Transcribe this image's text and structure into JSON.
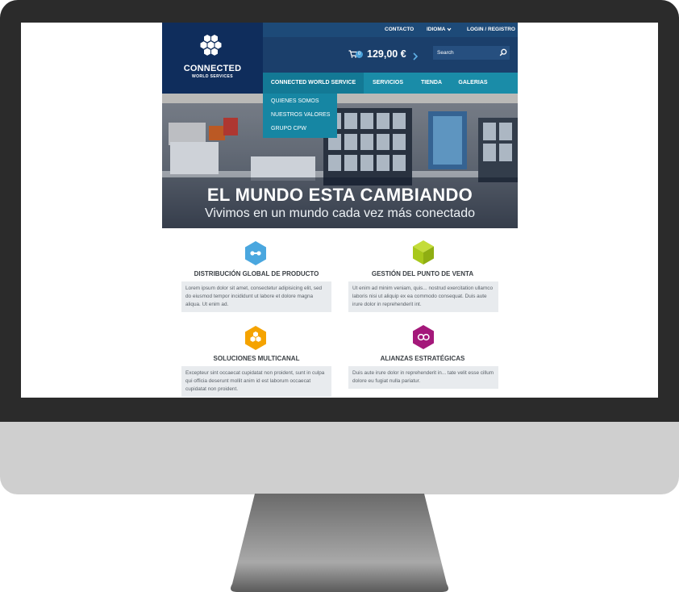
{
  "topbar": {
    "contacto": "CONTACTO",
    "idioma": "IDIOMA",
    "login": "LOGIN / REGISTRO"
  },
  "logo": {
    "title": "CONNECTED",
    "subtitle": "WORLD SERVICES"
  },
  "header": {
    "cart_count": "0",
    "price": "129,00 €",
    "search_placeholder": "Search"
  },
  "nav": {
    "items": [
      {
        "label": "CONNECTED WORLD SERVICE"
      },
      {
        "label": "SERVICIOS"
      },
      {
        "label": "TIENDA"
      },
      {
        "label": "GALERIAS"
      }
    ]
  },
  "dropdown": {
    "items": [
      {
        "label": "QUIENES SOMOS"
      },
      {
        "label": "NUESTROS VALORES"
      },
      {
        "label": "GRUPO CPW"
      }
    ]
  },
  "hero": {
    "title": "EL MUNDO ESTA CAMBIANDO",
    "subtitle": "Vivimos en un mundo cada vez más conectado"
  },
  "features": [
    {
      "title": "DISTRIBUCIÓN GLOBAL DE PRODUCTO",
      "text": "Lorem ipsum dolor sit amet, consectetur adipisicing elit, sed do eiusmod tempor incididunt ut labore et dolore magna aliqua. Ut enim ad.",
      "color": "#4aa7df"
    },
    {
      "title": "GESTIÓN DEL PUNTO DE VENTA",
      "text": "Ut enim ad minim veniam, quis... nostrud exercitation ullamco laboris nisi ut aliquip ex ea commodo consequat. Duis aute irure dolor in reprehenderit int.",
      "color": "#a8c81b"
    },
    {
      "title": "SOLUCIONES MULTICANAL",
      "text": "Excepteur sint occaecat cupidatat non proident, sunt in culpa qui officia deserunt mollit anim id est laborum occaecat cupidatat non proident.",
      "color": "#f5a300"
    },
    {
      "title": "ALIANZAS ESTRATÉGICAS",
      "text": "Duis aute irure dolor in reprehenderit in... tate velit esse cillum dolore eu fugiat nulla pariatur.",
      "color": "#a4187a"
    }
  ],
  "colors": {
    "navy": "#0f2d5c",
    "header_blue": "#1b3f6b",
    "teal_nav": "#1a8ca8",
    "box_gray": "#e8ebee"
  }
}
